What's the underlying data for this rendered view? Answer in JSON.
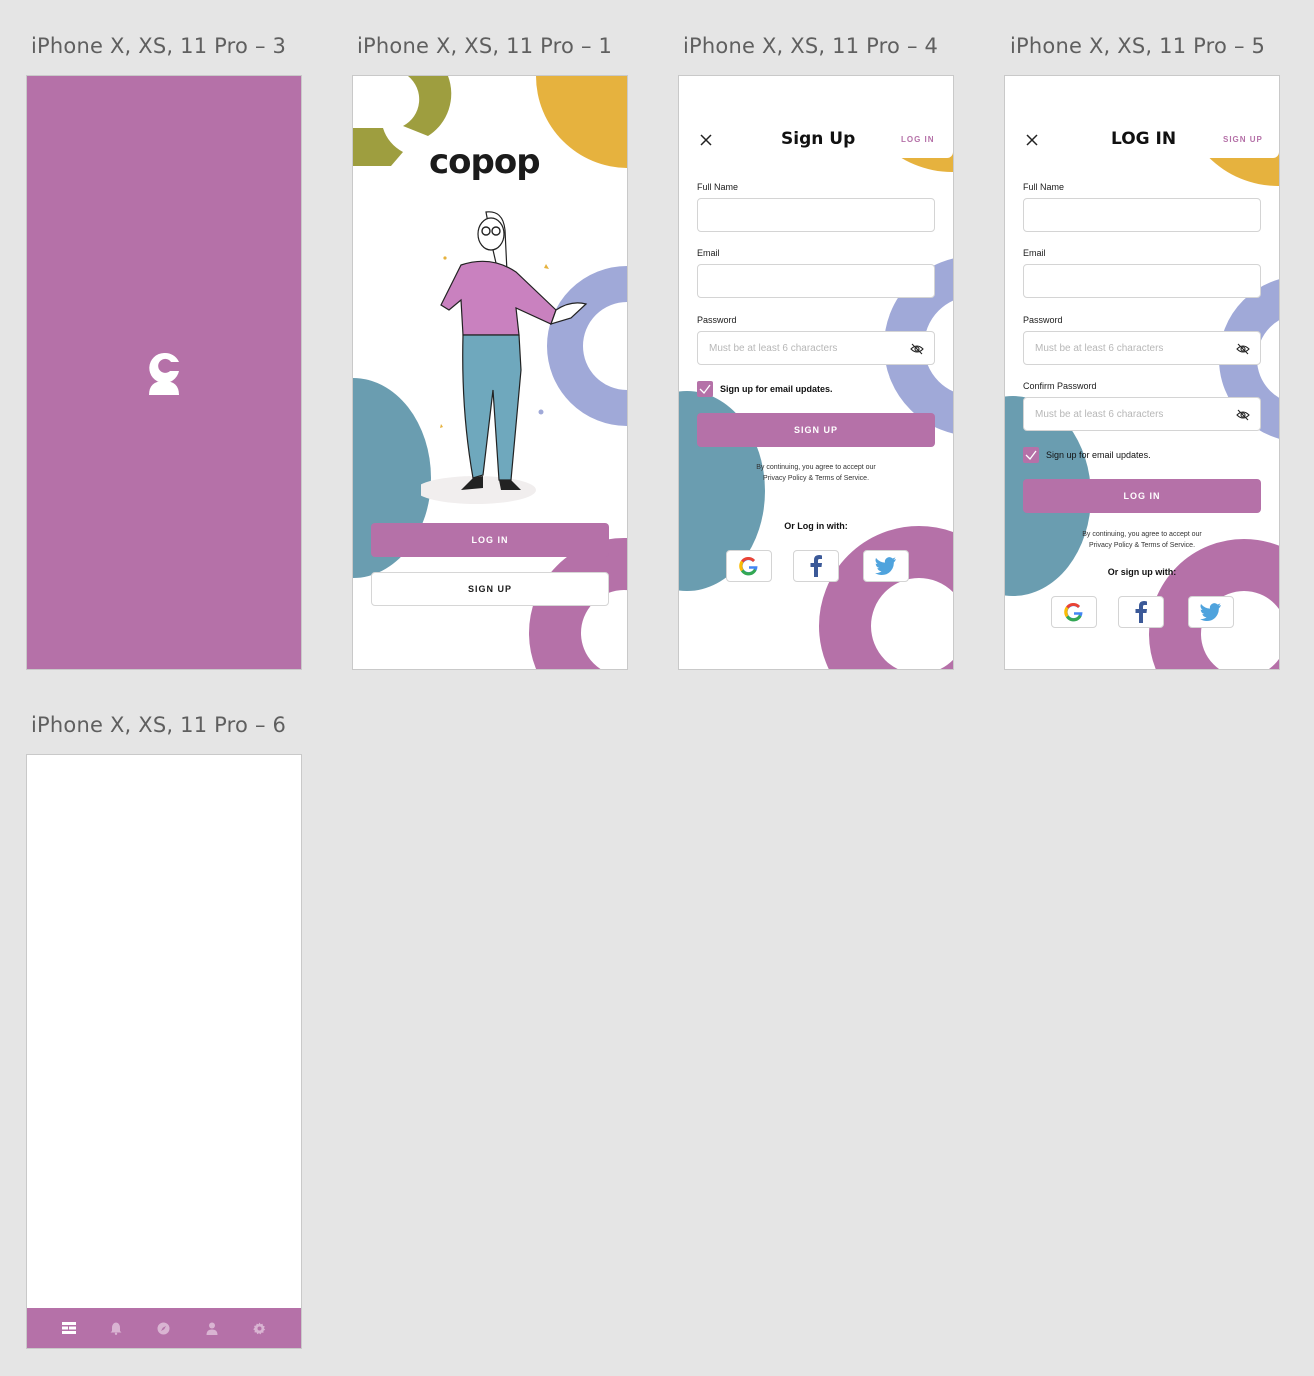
{
  "artboards": [
    {
      "title": "iPhone X, XS, 11 Pro – 3"
    },
    {
      "title": "iPhone X, XS, 11 Pro – 1"
    },
    {
      "title": "iPhone X, XS, 11 Pro – 4"
    },
    {
      "title": "iPhone X, XS, 11 Pro – 5"
    },
    {
      "title": "iPhone X, XS, 11 Pro – 6"
    }
  ],
  "colors": {
    "brand_purple": "#b571a8",
    "olive": "#9e9e3f",
    "mustard": "#e6b23e",
    "periwinkle": "#a0a9d8",
    "teal": "#6a9db0",
    "canvas": "#e5e5e5"
  },
  "splash": {
    "logo_icon": "copop-c-icon"
  },
  "welcome": {
    "brand": "copop",
    "login_label": "LOG IN",
    "signup_label": "SIGN UP"
  },
  "signup": {
    "title": "Sign Up",
    "header_link": "LOG IN",
    "full_name_label": "Full Name",
    "email_label": "Email",
    "password_label": "Password",
    "password_placeholder": "Must be at least 6 characters",
    "checkbox_label": "Sign up for email updates.",
    "submit_label": "SIGN UP",
    "legal_line1": "By continuing, you agree to accept our",
    "legal_line2": "Privacy Policy & Terms of Service.",
    "social_prompt": "Or Log in with:"
  },
  "login": {
    "title": "LOG IN",
    "header_link": "SIGN UP",
    "full_name_label": "Full Name",
    "email_label": "Email",
    "password_label": "Password",
    "password_placeholder": "Must be at least 6 characters",
    "confirm_label": "Confirm Password",
    "confirm_placeholder": "Must be at least 6 characters",
    "checkbox_label": "Sign up for email updates.",
    "submit_label": "LOG IN",
    "legal_line1": "By continuing, you agree to accept our",
    "legal_line2": "Privacy Policy & Terms of Service.",
    "social_prompt": "Or sign up with:"
  },
  "home": {
    "tabs": [
      {
        "icon": "dashboard-icon"
      },
      {
        "icon": "bell-icon"
      },
      {
        "icon": "compass-icon"
      },
      {
        "icon": "user-icon"
      },
      {
        "icon": "gear-icon"
      }
    ]
  }
}
